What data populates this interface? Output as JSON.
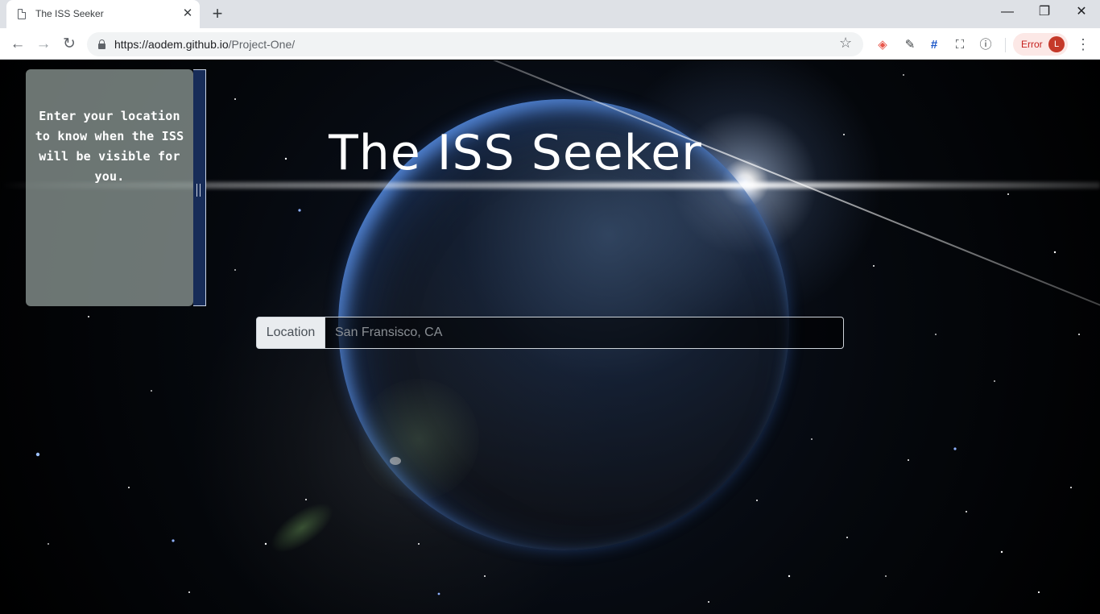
{
  "browser": {
    "tab_title": "The ISS Seeker",
    "url_host": "https://aodem.github.io",
    "url_path": "/Project-One/",
    "status_label": "Error",
    "avatar_initial": "L"
  },
  "page": {
    "title": "The ISS Seeker",
    "info_text": "Enter your location to know when the ISS will be visible for you.",
    "location_label": "Location",
    "location_placeholder": "San Fransisco, CA"
  }
}
